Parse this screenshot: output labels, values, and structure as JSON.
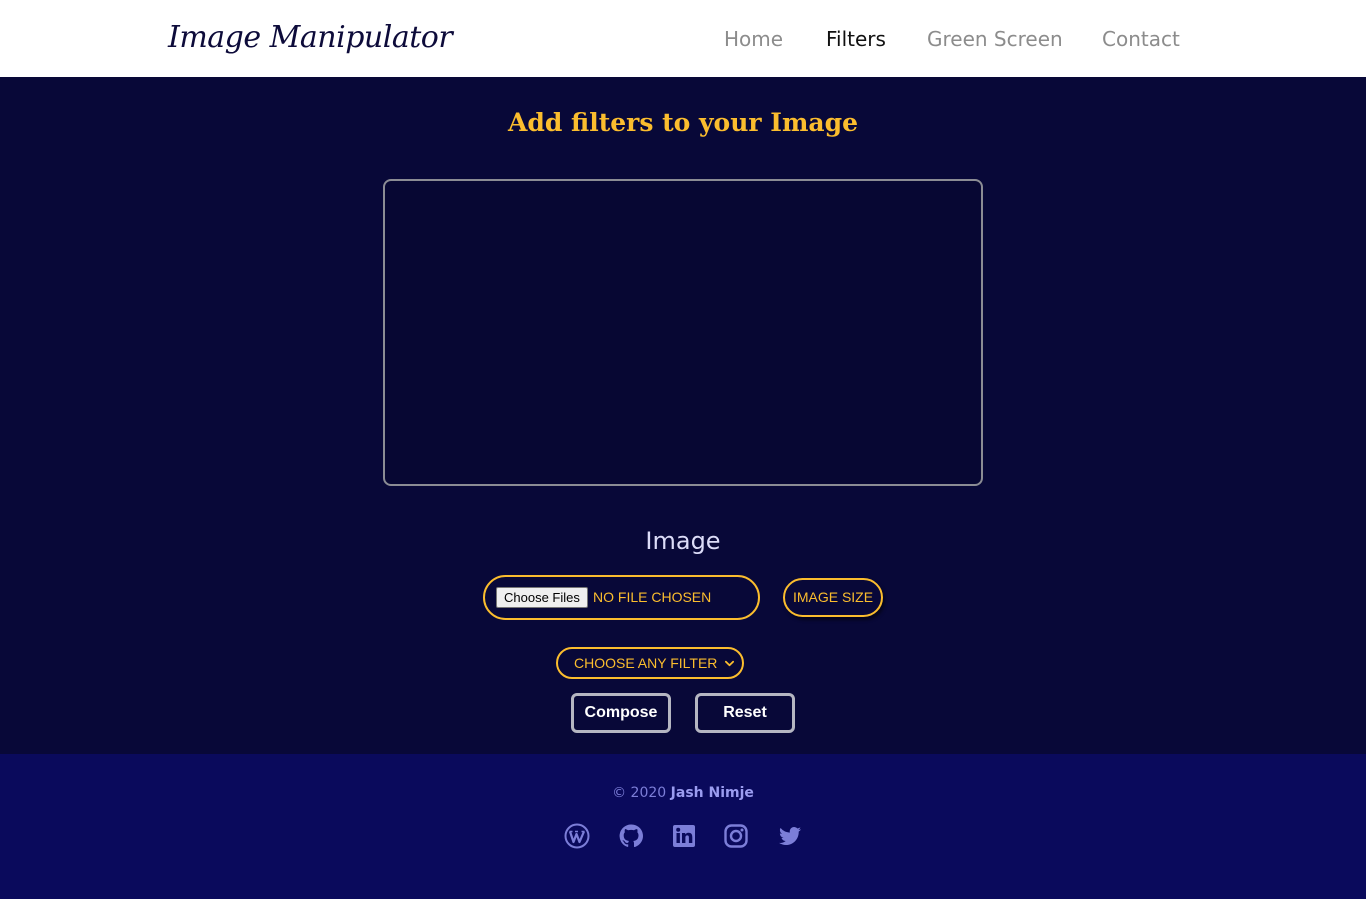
{
  "navbar": {
    "brand": "Image Manipulator",
    "links": [
      {
        "label": "Home",
        "active": false
      },
      {
        "label": "Filters",
        "active": true
      },
      {
        "label": "Green Screen",
        "active": false
      },
      {
        "label": "Contact",
        "active": false
      }
    ]
  },
  "main": {
    "title": "Add filters to your Image",
    "section_label": "Image",
    "file_input": {
      "button_label": "Choose Files",
      "status": "NO FILE CHOSEN"
    },
    "image_size_button": "IMAGE SIZE",
    "filter_select": {
      "selected": "CHOOSE ANY FILTER",
      "icon": "chevron-down-icon"
    },
    "compose_button": "Compose",
    "reset_button": "Reset"
  },
  "footer": {
    "copyright_prefix": "© 2020",
    "author": "Jash Nimje",
    "social_icons": [
      "wordpress-icon",
      "github-icon",
      "linkedin-icon",
      "instagram-icon",
      "twitter-icon"
    ]
  },
  "colors": {
    "accent": "#fbbd2e",
    "main_bg": "#080838",
    "footer_bg": "#0a0a5c",
    "footer_text": "#7c7ed8",
    "nav_text": "#8c8c8c",
    "nav_active": "#111111"
  }
}
